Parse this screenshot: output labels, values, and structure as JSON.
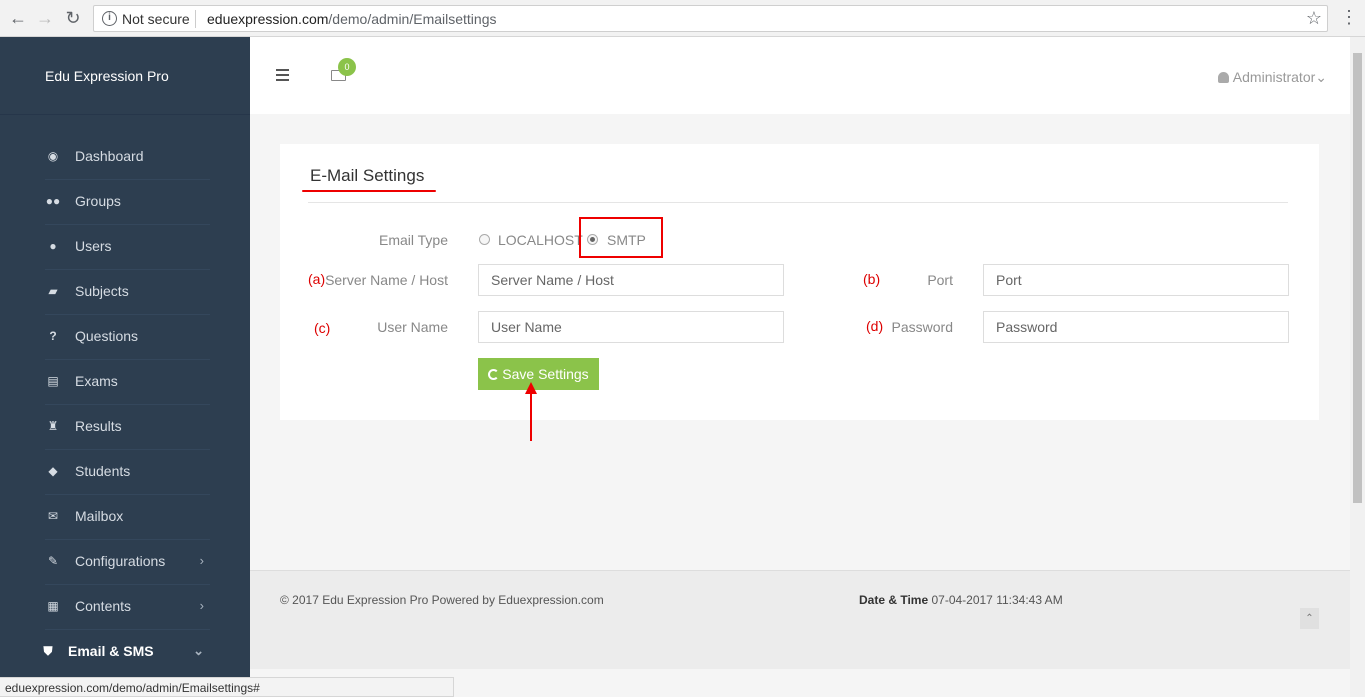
{
  "browser": {
    "security_label": "Not secure",
    "url_host": "eduexpression.com",
    "url_path": "/demo/admin/Emailsettings",
    "status_url": "eduexpression.com/demo/admin/Emailsettings#"
  },
  "sidebar": {
    "brand": "Edu Expression Pro",
    "items": [
      {
        "label": "Dashboard",
        "icon": "dashboard-icon"
      },
      {
        "label": "Groups",
        "icon": "users-group-icon"
      },
      {
        "label": "Users",
        "icon": "user-icon"
      },
      {
        "label": "Subjects",
        "icon": "book-icon"
      },
      {
        "label": "Questions",
        "icon": "question-icon"
      },
      {
        "label": "Exams",
        "icon": "list-icon"
      },
      {
        "label": "Results",
        "icon": "trophy-icon"
      },
      {
        "label": "Students",
        "icon": "graduation-cap-icon"
      },
      {
        "label": "Mailbox",
        "icon": "envelope-icon"
      },
      {
        "label": "Configurations",
        "icon": "wrench-icon",
        "arrow": "›"
      },
      {
        "label": "Contents",
        "icon": "newspaper-icon",
        "arrow": "›"
      },
      {
        "label": "Email & SMS",
        "icon": "shield-icon",
        "arrow": "⌄",
        "active": true
      }
    ]
  },
  "header": {
    "mail_count": "0",
    "user_label": "Administrator"
  },
  "email_settings": {
    "title": "E-Mail Settings",
    "email_type_label": "Email Type",
    "type_options": [
      "LOCALHOST",
      "SMTP"
    ],
    "selected_type": "SMTP",
    "server_label": "Server Name / Host",
    "server_placeholder": "Server Name / Host",
    "port_label": "Port",
    "port_placeholder": "Port",
    "username_label": "User Name",
    "username_placeholder": "User Name",
    "password_label": "Password",
    "password_placeholder": "Password",
    "save_label": "Save Settings",
    "annotations": {
      "a": "(a)",
      "b": "(b)",
      "c": "(c)",
      "d": "(d)"
    }
  },
  "footer": {
    "copyright": "© 2017 Edu Expression Pro Powered by Eduexpression.com",
    "datetime_label": "Date & Time",
    "datetime_value": " 07-04-2017 11:34:43 AM"
  },
  "colors": {
    "sidebar_bg": "#2d3e50",
    "accent_green": "#8bc34a",
    "annotation_red": "#e00000"
  }
}
